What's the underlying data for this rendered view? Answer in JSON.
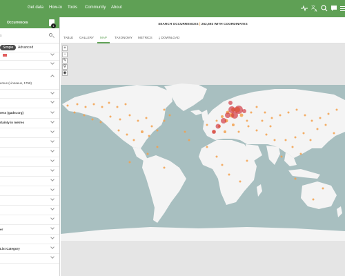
{
  "nav": {
    "items": [
      "Get data",
      "How-to",
      "Tools",
      "Community",
      "About"
    ]
  },
  "sidebar": {
    "title": "Occurrences",
    "badge": "1",
    "search_placeholder": "s",
    "toggle_simple": "Simple",
    "toggle_advanced": "Advanced",
    "taxon_value": "ersus (Linnaeus, 1758)",
    "filters": [
      "ress (gadm.org)",
      "rtainty in metres",
      "er",
      "List Category"
    ]
  },
  "header": {
    "title_left": "SEARCH OCCURRENCES",
    "separator": "|",
    "title_right": "252,693 WITH COORDINATES"
  },
  "tabs": [
    "TABLE",
    "GALLERY",
    "MAP",
    "TAXONOMY",
    "METRICS",
    "DOWNLOAD"
  ],
  "active_tab": "MAP",
  "map_controls": [
    "+",
    "−",
    "✎",
    "⚲",
    "◉"
  ],
  "colors": {
    "brand_green": "#5fa055",
    "ocean": "#a8bfc0",
    "land": "#f4f4f4",
    "dot_orange": "#f2a04c",
    "dot_red": "#d0303a"
  }
}
